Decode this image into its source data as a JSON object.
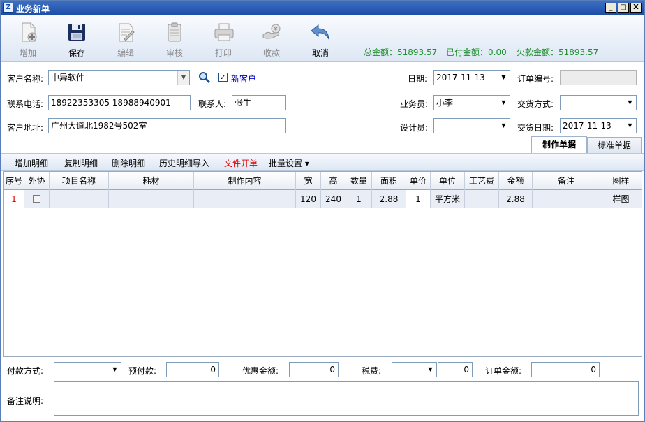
{
  "window": {
    "title": "业务新单",
    "controls": [
      "_",
      "□",
      "X"
    ]
  },
  "toolbar": {
    "buttons": [
      {
        "label": "增加",
        "icon": "add-document-icon",
        "enabled": false
      },
      {
        "label": "保存",
        "icon": "floppy-disk-icon",
        "enabled": true
      },
      {
        "label": "编辑",
        "icon": "edit-document-icon",
        "enabled": false
      },
      {
        "label": "审核",
        "icon": "clipboard-icon",
        "enabled": false
      },
      {
        "label": "打印",
        "icon": "printer-icon",
        "enabled": false
      },
      {
        "label": "收款",
        "icon": "money-icon",
        "enabled": false
      },
      {
        "label": "取消",
        "icon": "undo-arrow-icon",
        "enabled": true
      }
    ],
    "totals": {
      "total": "总金额：51893.57",
      "paid": "已付金额：0.00",
      "owed": "欠款金额：51893.57"
    },
    "totals_color": "#1f8f2d"
  },
  "form": {
    "customer_name_label": "客户名称:",
    "customer_name_value": "中异软件",
    "new_customer_label": "新客户",
    "new_customer_checked": "✓",
    "phone_label": "联系电话:",
    "phone_value": "18922353305 18988940901",
    "contact_label": "联系人:",
    "contact_value": "张生",
    "address_label": "客户地址:",
    "address_value": "广州大道北1982号502室",
    "date_label": "日期:",
    "date_value": "2017-11-13",
    "order_no_label": "订单编号:",
    "order_no_value": "",
    "salesman_label": "业务员:",
    "salesman_value": "小李",
    "delivery_method_label": "交货方式:",
    "delivery_method_value": "",
    "designer_label": "设计员:",
    "designer_value": "",
    "delivery_date_label": "交货日期:",
    "delivery_date_value": "2017-11-13"
  },
  "tabs": [
    {
      "label": "制作单据",
      "active": true
    },
    {
      "label": "标准单据",
      "active": false
    }
  ],
  "detail_toolbar": {
    "add": "增加明细",
    "copy": "复制明细",
    "delete": "删除明细",
    "history": "历史明细导入",
    "file": "文件开单",
    "batch": "批量设置 ▾"
  },
  "grid": {
    "columns": [
      "序号",
      "外协",
      "项目名称",
      "耗材",
      "制作内容",
      "宽",
      "高",
      "数量",
      "面积",
      "单价",
      "单位",
      "工艺费",
      "金额",
      "备注",
      "图样"
    ],
    "rows": [
      {
        "seq": "1",
        "outsource": "",
        "item": "",
        "material": "",
        "content": "",
        "width": "120",
        "height": "240",
        "qty": "1",
        "area": "2.88",
        "price": "1",
        "unit": "平方米",
        "craft_fee": "",
        "amount": "2.88",
        "note": "",
        "sample": "样图"
      }
    ]
  },
  "bottom": {
    "payment_method_label": "付款方式:",
    "payment_method_value": "",
    "prepaid_label": "预付款:",
    "prepaid_value": "0",
    "discount_label": "优惠金额:",
    "discount_value": "0",
    "tax_label": "税费:",
    "tax_type_value": "",
    "tax_value": "0",
    "order_amount_label": "订单金额:",
    "order_amount_value": "0",
    "remarks_label": "备注说明:",
    "remarks_value": ""
  }
}
